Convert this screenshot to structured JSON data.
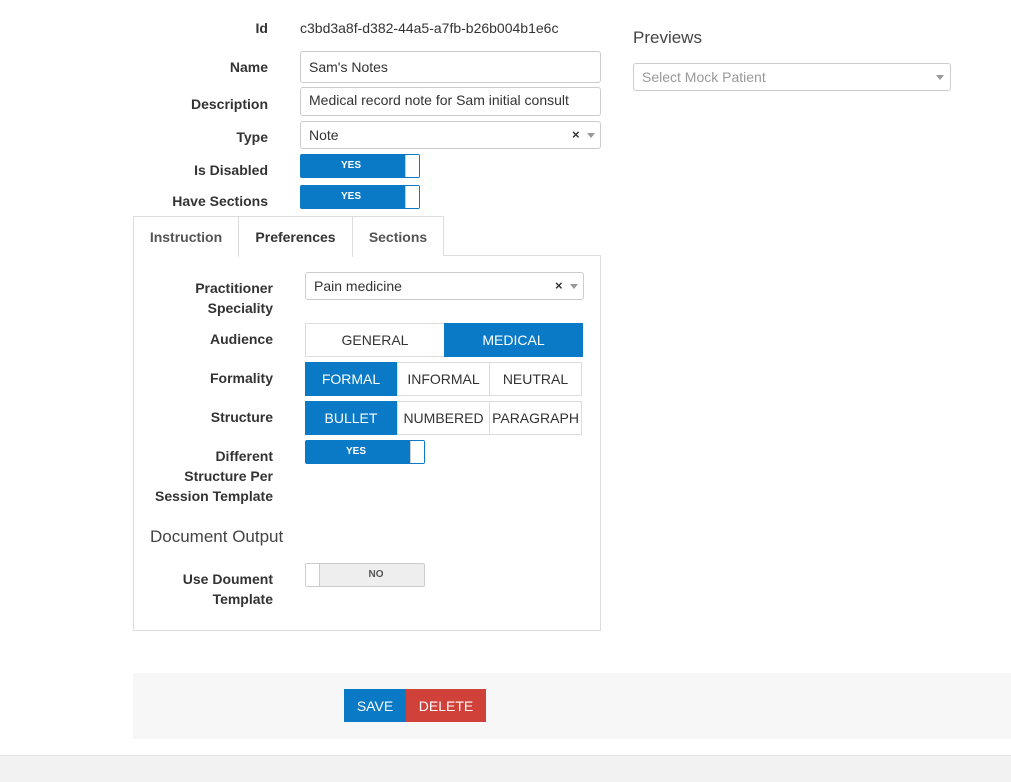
{
  "form": {
    "id_label": "Id",
    "id_value": "c3bd3a8f-d382-44a5-a7fb-b26b004b1e6c",
    "name_label": "Name",
    "name_value": "Sam's Notes",
    "description_label": "Description",
    "description_value": "Medical record note for Sam initial consult",
    "type_label": "Type",
    "type_value": "Note",
    "is_disabled_label": "Is Disabled",
    "is_disabled_value": "YES",
    "have_sections_label": "Have Sections",
    "have_sections_value": "YES"
  },
  "previews": {
    "title": "Previews",
    "placeholder": "Select Mock Patient"
  },
  "tabs": [
    {
      "label": "Instruction",
      "active": false
    },
    {
      "label": "Preferences",
      "active": true
    },
    {
      "label": "Sections",
      "active": false
    }
  ],
  "preferences": {
    "practitioner_label_1": "Practitioner",
    "practitioner_label_2": "Speciality",
    "practitioner_value": "Pain medicine",
    "audience_label": "Audience",
    "audience_options": [
      "GENERAL",
      "MEDICAL"
    ],
    "audience_selected": "MEDICAL",
    "formality_label": "Formality",
    "formality_options": [
      "FORMAL",
      "INFORMAL",
      "NEUTRAL"
    ],
    "formality_selected": "FORMAL",
    "structure_label": "Structure",
    "structure_options": [
      "BULLET",
      "NUMBERED",
      "PARAGRAPH"
    ],
    "structure_selected": "BULLET",
    "different_label_1": "Different",
    "different_label_2": "Structure Per",
    "different_label_3": "Session Template",
    "different_value": "YES",
    "document_output_heading": "Document Output",
    "use_doc_label_1": "Use Doument",
    "use_doc_label_2": "Template",
    "use_doc_value": "NO"
  },
  "actions": {
    "save_label": "SAVE",
    "delete_label": "DELETE"
  },
  "colors": {
    "accent": "#0a7ac6",
    "danger": "#d0413a"
  },
  "icons": {
    "clear": "clear-icon",
    "caret": "chevron-down-icon"
  }
}
